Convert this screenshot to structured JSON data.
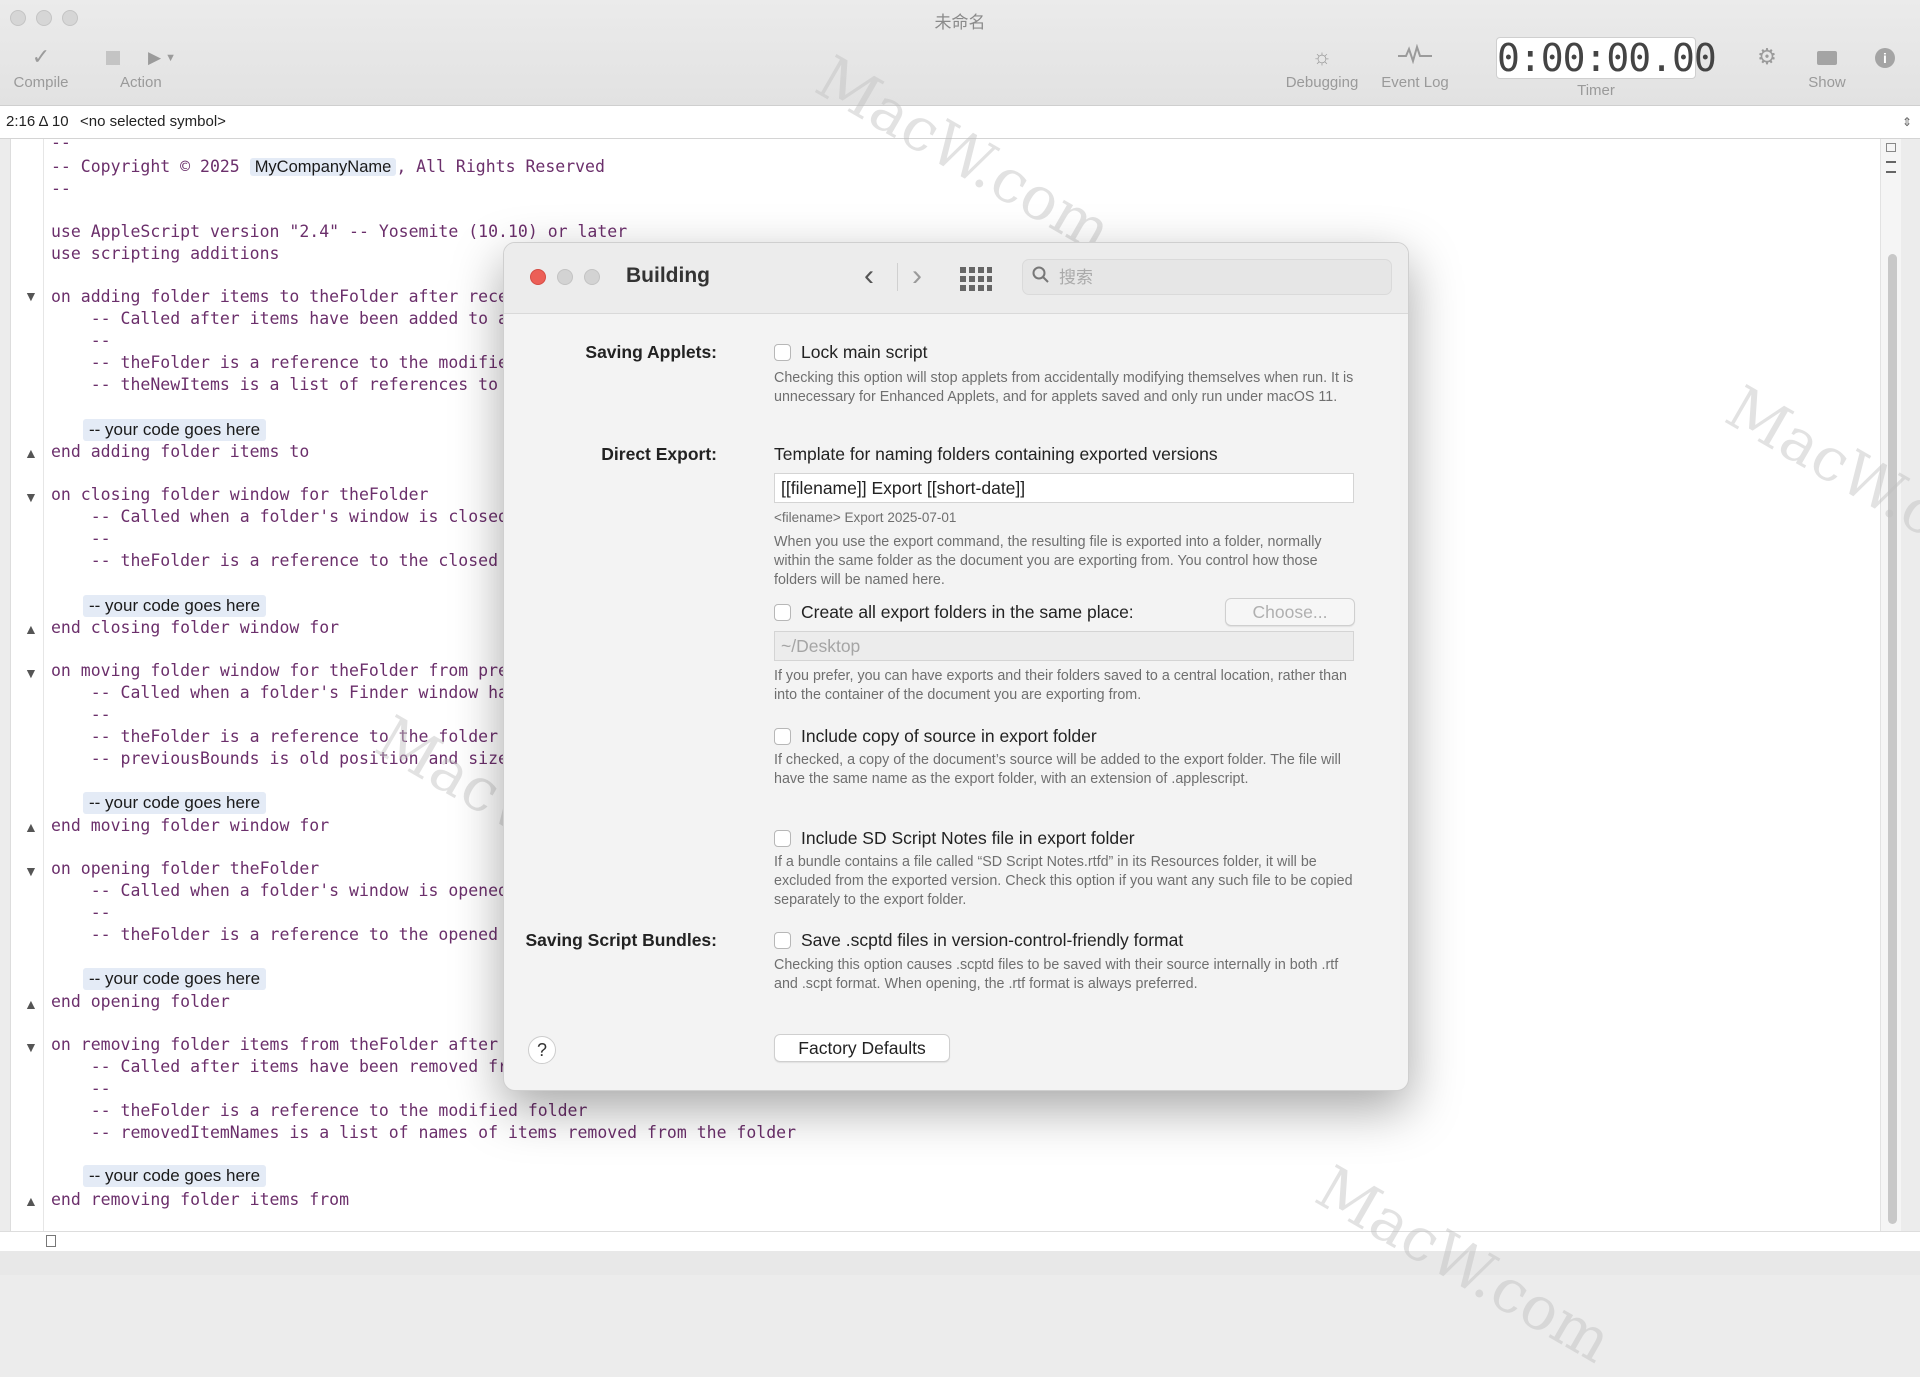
{
  "window": {
    "title": "未命名"
  },
  "toolbar": {
    "compile_label": "Compile",
    "action_label": "Action",
    "debugging_label": "Debugging",
    "event_log_label": "Event Log",
    "timer_value": "0:00:00.00",
    "timer_label": "Timer",
    "show_label": "Show"
  },
  "navigator": {
    "position": "2:16 Δ 10",
    "symbol": "<no selected symbol>"
  },
  "editor": {
    "copyright_prefix": "-- Copyright © 2025 ",
    "company": "MyCompanyName",
    "copyright_suffix": ", All Rights Reserved",
    "placeholder": "-- your code goes here",
    "lines": [
      "--",
      "--",
      "use AppleScript version \"2.4\" -- Yosemite (10.10) or later",
      "use scripting additions",
      "on adding folder items to theFolder after recei",
      "    -- Called after items have been added to a",
      "    --",
      "    -- theFolder is a reference to the modified",
      "    -- theNewItems is a list of references to t",
      "end adding folder items to",
      "on closing folder window for theFolder",
      "    -- Called when a folder's window is closed",
      "    --",
      "    -- theFolder is a reference to the closed f",
      "end closing folder window for",
      "on moving folder window for theFolder from prev",
      "    -- Called when a folder's Finder window has",
      "    --",
      "    -- theFolder is a reference to the folder b",
      "    -- previousBounds is old position and size",
      "end moving folder window for",
      "on opening folder theFolder",
      "    -- Called when a folder's window is opened",
      "    --",
      "    -- theFolder is a reference to the opened f",
      "end opening folder",
      "on removing folder items from theFolder after l",
      "    -- Called after items have been removed fro",
      "    --",
      "    -- theFolder is a reference to the modified folder",
      "    -- removedItemNames is a list of names of items removed from the folder",
      "end removing folder items from"
    ]
  },
  "dialog": {
    "title": "Building",
    "search_placeholder": "搜索",
    "saving_applets": {
      "label": "Saving Applets:",
      "option": "Lock main script",
      "help": "Checking this option will stop applets from accidentally modifying themselves when run. It is unnecessary for Enhanced Applets, and for applets saved and only run under macOS 11."
    },
    "direct_export": {
      "label": "Direct Export:",
      "heading": "Template for naming folders containing exported versions",
      "template_value": "[[filename]] Export [[short-date]]",
      "preview": "<filename> Export 2025-07-01",
      "help": "When you use the export command, the resulting file is exported into a folder, normally within the same folder as the document you are exporting from. You control how those folders will be named here.",
      "same_place_option": "Create all export folders in the same place:",
      "choose_button": "Choose...",
      "location_value": "~/Desktop",
      "same_place_help": "If you prefer, you can have exports and their folders saved to a central location, rather than into the container of the document you are exporting from.",
      "include_source_option": "Include copy of source in export folder",
      "include_source_help": "If checked, a copy of the document’s source will be added to the export folder. The file will have the same name as the export folder, with an extension of .applescript.",
      "include_notes_option": "Include SD Script Notes file in export folder",
      "include_notes_help": "If a bundle contains a file called “SD Script Notes.rtfd” in its Resources folder, it will be excluded from the exported version. Check this option if you want any such file to be copied separately to the export folder."
    },
    "saving_bundles": {
      "label": "Saving Script Bundles:",
      "option": "Save .scptd files in version-control-friendly format",
      "help": "Checking this option causes .scptd files to be saved with their source internally in both .rtf and .scpt format. When opening, the .rtf format is always preferred."
    },
    "factory_defaults_button": "Factory Defaults",
    "help_button": "?"
  },
  "watermark": "MacW.com",
  "colors": {
    "code": "#6b2f6b",
    "close": "#ec5f57",
    "placeholder_bg": "#e4ebf6"
  }
}
